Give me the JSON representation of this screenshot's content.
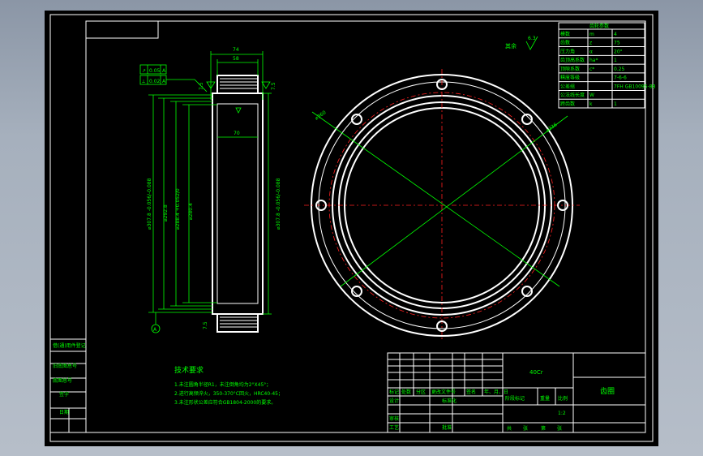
{
  "drawing": {
    "surface_roughness": "其余",
    "surface_roughness_value": "6.3",
    "requirements_title": "技术要求",
    "requirements": [
      "1.未注圆角半径R1，未注倒角均为2°X45°；",
      "2.进行高频淬火，350-370°C回火，HRC40-45；",
      "3.未注形状公差应符合GB1804-2000的要求。"
    ],
    "part_name": "齿圈",
    "material": "40Cr",
    "scale": "1:2",
    "scale_label": "比例",
    "weight_label": "重量",
    "stage_label": "阶段标记",
    "sheet_labels": [
      "共",
      "张",
      "第",
      "张"
    ],
    "title_labels": [
      "标记",
      "处数",
      "分区",
      "更改文件号",
      "签名",
      "年、月、日",
      "设计",
      "标准化",
      "审核",
      "工艺",
      "批准"
    ],
    "dims_top": [
      "74",
      "58"
    ],
    "dim_inner_width": "70",
    "dims_left": [
      "⌀307.8 -0.056/-0.088",
      "⌀292.8",
      "⌀288.4 +0.052/0",
      "⌀280.4"
    ],
    "dim_right": "⌀307.8 -0.056/-0.088",
    "dims_circle": [
      "⌀360",
      "⌀336"
    ],
    "tolerance_frames": [
      {
        "symbol": "↗",
        "value": "0.05",
        "datum": "A"
      },
      {
        "symbol": "⟂",
        "value": "0.02",
        "datum": "A"
      }
    ],
    "datum_label": "A",
    "side_labels": [
      "7.5",
      "7.5"
    ],
    "parameter_table": {
      "header": "齿轮参数",
      "rows": [
        [
          "模数",
          "m",
          "4"
        ],
        [
          "齿数",
          "z",
          "75"
        ],
        [
          "压力角",
          "α",
          "20°"
        ],
        [
          "齿顶高系数",
          "ha*",
          "1"
        ],
        [
          "顶隙系数",
          "c*",
          "0.25"
        ],
        [
          "精度等级",
          "",
          "7-6-6"
        ],
        [
          "公差组",
          "",
          "7FH GB10095-88"
        ],
        [
          "公法线长度",
          "W",
          ""
        ],
        [
          "跨齿数",
          "k",
          "1"
        ]
      ]
    },
    "left_strip_labels": [
      "借(通)用件登记",
      "旧底图总号",
      "底图总号",
      "签字",
      "日期"
    ]
  }
}
